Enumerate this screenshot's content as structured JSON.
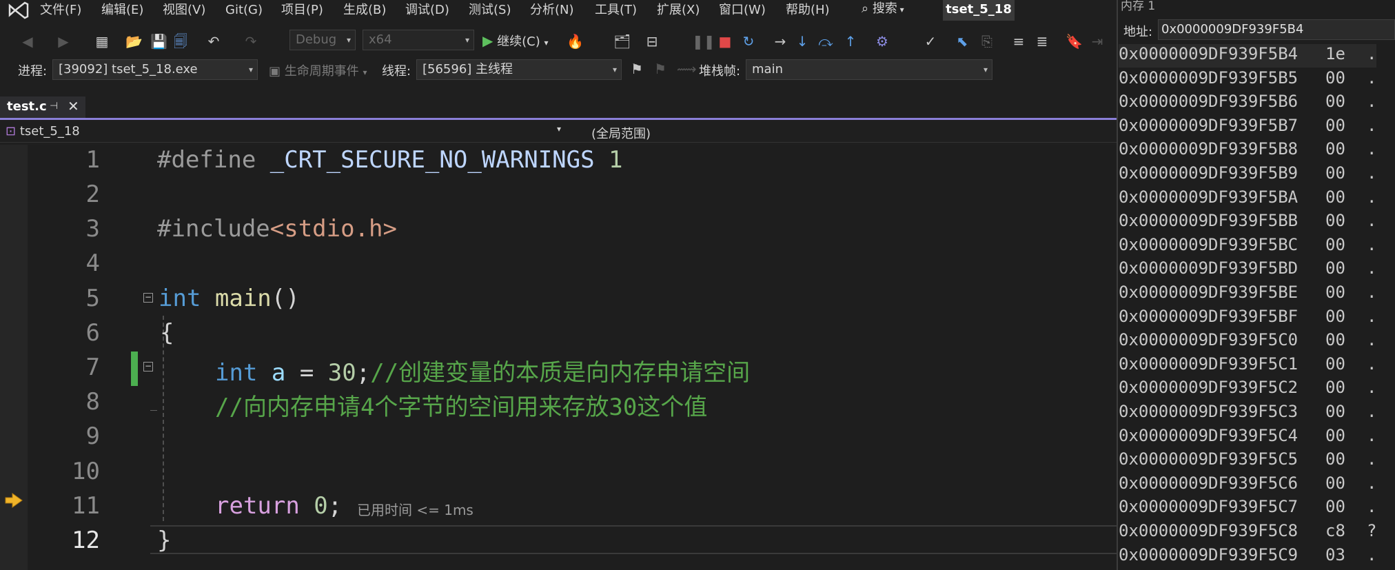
{
  "menu": [
    "文件(F)",
    "编辑(E)",
    "视图(V)",
    "Git(G)",
    "项目(P)",
    "生成(B)",
    "调试(D)",
    "测试(S)",
    "分析(N)",
    "工具(T)",
    "扩展(X)",
    "窗口(W)",
    "帮助(H)"
  ],
  "search_label": "搜索",
  "solution_name": "tset_5_18",
  "toolbar": {
    "config": "Debug",
    "platform": "x64",
    "continue_label": "继续(C)"
  },
  "debug_bar": {
    "process_label": "进程:",
    "process_value": "[39092] tset_5_18.exe",
    "lifecycle_label": "生命周期事件",
    "thread_label": "线程:",
    "thread_value": "[56596] 主线程",
    "stack_label": "堆栈帧:",
    "stack_value": "main"
  },
  "editor": {
    "file_tab": "test.c",
    "project_scope": "tset_5_18",
    "global_scope": "(全局范围)",
    "line_numbers": [
      "1",
      "2",
      "3",
      "4",
      "5",
      "6",
      "7",
      "8",
      "9",
      "10",
      "11",
      "12"
    ],
    "current_line": "12",
    "lines": {
      "l1_pp": "#define ",
      "l1_macro": "_CRT_SECURE_NO_WARNINGS",
      "l1_num": " 1",
      "l3_pp": "#include",
      "l3_str": "<stdio.h>",
      "l5_kw": "int",
      "l5_fn": " main",
      "l5_paren": "()",
      "l6": "{",
      "l7_kw": "int",
      "l7_var": " a",
      "l7_op": " = ",
      "l7_num": "30",
      "l7_semi": ";",
      "l7_comment": "//创建变量的本质是向内存申请空间",
      "l8_comment": "//向内存申请4个字节的空间用来存放30这个值",
      "l11_kw": "return",
      "l11_num": " 0",
      "l11_semi": ";",
      "l11_hint": "已用时间 <= 1ms",
      "l12": "}"
    }
  },
  "memory": {
    "title": "内存 1",
    "address_label": "地址:",
    "address_value": "0x0000009DF939F5B4",
    "rows": [
      {
        "addr": "0x0000009DF939F5B4",
        "val": "1e",
        "ch": "."
      },
      {
        "addr": "0x0000009DF939F5B5",
        "val": "00",
        "ch": "."
      },
      {
        "addr": "0x0000009DF939F5B6",
        "val": "00",
        "ch": "."
      },
      {
        "addr": "0x0000009DF939F5B7",
        "val": "00",
        "ch": "."
      },
      {
        "addr": "0x0000009DF939F5B8",
        "val": "00",
        "ch": "."
      },
      {
        "addr": "0x0000009DF939F5B9",
        "val": "00",
        "ch": "."
      },
      {
        "addr": "0x0000009DF939F5BA",
        "val": "00",
        "ch": "."
      },
      {
        "addr": "0x0000009DF939F5BB",
        "val": "00",
        "ch": "."
      },
      {
        "addr": "0x0000009DF939F5BC",
        "val": "00",
        "ch": "."
      },
      {
        "addr": "0x0000009DF939F5BD",
        "val": "00",
        "ch": "."
      },
      {
        "addr": "0x0000009DF939F5BE",
        "val": "00",
        "ch": "."
      },
      {
        "addr": "0x0000009DF939F5BF",
        "val": "00",
        "ch": "."
      },
      {
        "addr": "0x0000009DF939F5C0",
        "val": "00",
        "ch": "."
      },
      {
        "addr": "0x0000009DF939F5C1",
        "val": "00",
        "ch": "."
      },
      {
        "addr": "0x0000009DF939F5C2",
        "val": "00",
        "ch": "."
      },
      {
        "addr": "0x0000009DF939F5C3",
        "val": "00",
        "ch": "."
      },
      {
        "addr": "0x0000009DF939F5C4",
        "val": "00",
        "ch": "."
      },
      {
        "addr": "0x0000009DF939F5C5",
        "val": "00",
        "ch": "."
      },
      {
        "addr": "0x0000009DF939F5C6",
        "val": "00",
        "ch": "."
      },
      {
        "addr": "0x0000009DF939F5C7",
        "val": "00",
        "ch": "."
      },
      {
        "addr": "0x0000009DF939F5C8",
        "val": "c8",
        "ch": "?"
      },
      {
        "addr": "0x0000009DF939F5C9",
        "val": "03",
        "ch": "."
      }
    ]
  },
  "colors": {
    "accent": "#8a7fd8",
    "keyword": "#569cd6",
    "comment": "#57a64a",
    "change_marker": "#4caf50",
    "breakpoint_arrow": "#f0b429"
  }
}
